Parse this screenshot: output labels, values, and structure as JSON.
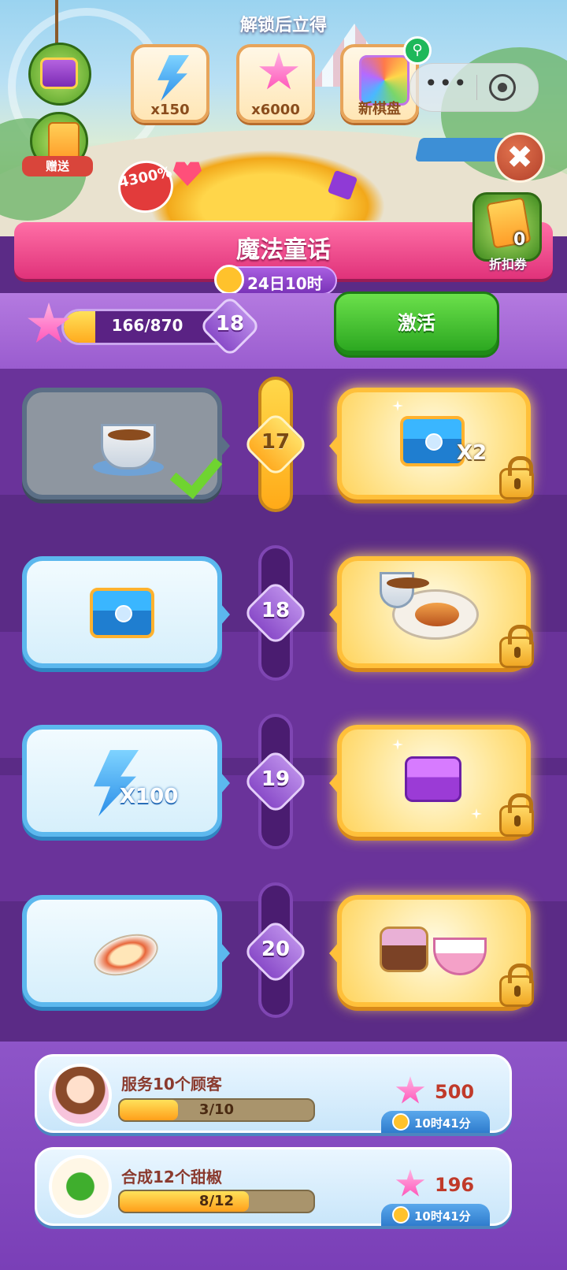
{
  "banner": {
    "unlock_caption": "解锁后立得",
    "rewards": [
      {
        "icon": "energy-bolt-icon",
        "label": "x150"
      },
      {
        "icon": "pink-star-icon",
        "label": "x6000"
      },
      {
        "icon": "new-board-icon",
        "label": "新棋盘"
      }
    ],
    "gift_label": "赠送",
    "bonus_badge": "4300%",
    "discount_count": "0",
    "discount_label": "折扣券",
    "close_icon": "close-icon"
  },
  "event": {
    "title": "魔法童话",
    "timer": "24日10时"
  },
  "progress": {
    "value": 166,
    "max": 870,
    "text": "166/870",
    "level": "18",
    "activate_label": "激活"
  },
  "levels": [
    {
      "num": "17",
      "done": true,
      "free": {
        "item": "tea-cup",
        "claimed": true
      },
      "paid": {
        "item": "blue-chest",
        "qty": "X2",
        "locked": true
      }
    },
    {
      "num": "18",
      "done": false,
      "free": {
        "item": "blue-chest",
        "qty": ""
      },
      "paid": {
        "item": "tea-set-meal",
        "locked": true
      }
    },
    {
      "num": "19",
      "done": false,
      "free": {
        "item": "energy-bolt",
        "qty": "X100"
      },
      "paid": {
        "item": "purple-chest",
        "locked": true
      }
    },
    {
      "num": "20",
      "done": false,
      "free": {
        "item": "omelet-dish"
      },
      "paid": {
        "item": "dessert-set",
        "locked": true
      }
    }
  ],
  "tasks": [
    {
      "title": "服务10个顾客",
      "progress": 3,
      "goal": 10,
      "progress_text": "3/10",
      "points": "500",
      "timer": "10时41分"
    },
    {
      "title": "合成12个甜椒",
      "progress": 8,
      "goal": 12,
      "progress_text": "8/12",
      "points": "196",
      "timer": "10时41分"
    }
  ],
  "colors": {
    "accent_pink": "#e0327a",
    "activate_green": "#27a31d",
    "grid_purple": "#5b2b86"
  }
}
